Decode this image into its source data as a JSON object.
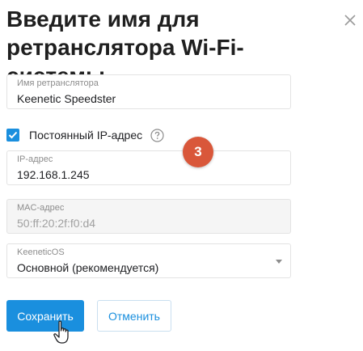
{
  "dialog": {
    "title": "Введите имя для ретранслятора Wi-Fi-системы",
    "close_icon": "close-icon"
  },
  "fields": {
    "repeater_name": {
      "label": "Имя ретранслятора",
      "value": "Keenetic Speedster"
    },
    "static_ip_checkbox": {
      "label": "Постоянный IP-адрес",
      "checked": true,
      "help_icon": "question-circle-icon"
    },
    "ip_address": {
      "label": "IP-адрес",
      "value": "192.168.1.245"
    },
    "mac_address": {
      "label": "MAC-адрес",
      "value": "50:ff:20:2f:f0:d4"
    },
    "keeneticos": {
      "label": "KeeneticOS",
      "selected": "Основной (рекомендуется)"
    }
  },
  "step_badge": "3",
  "buttons": {
    "save": "Сохранить",
    "cancel": "Отменить"
  },
  "colors": {
    "accent": "#1a8fde",
    "badge": "#d9573a"
  }
}
